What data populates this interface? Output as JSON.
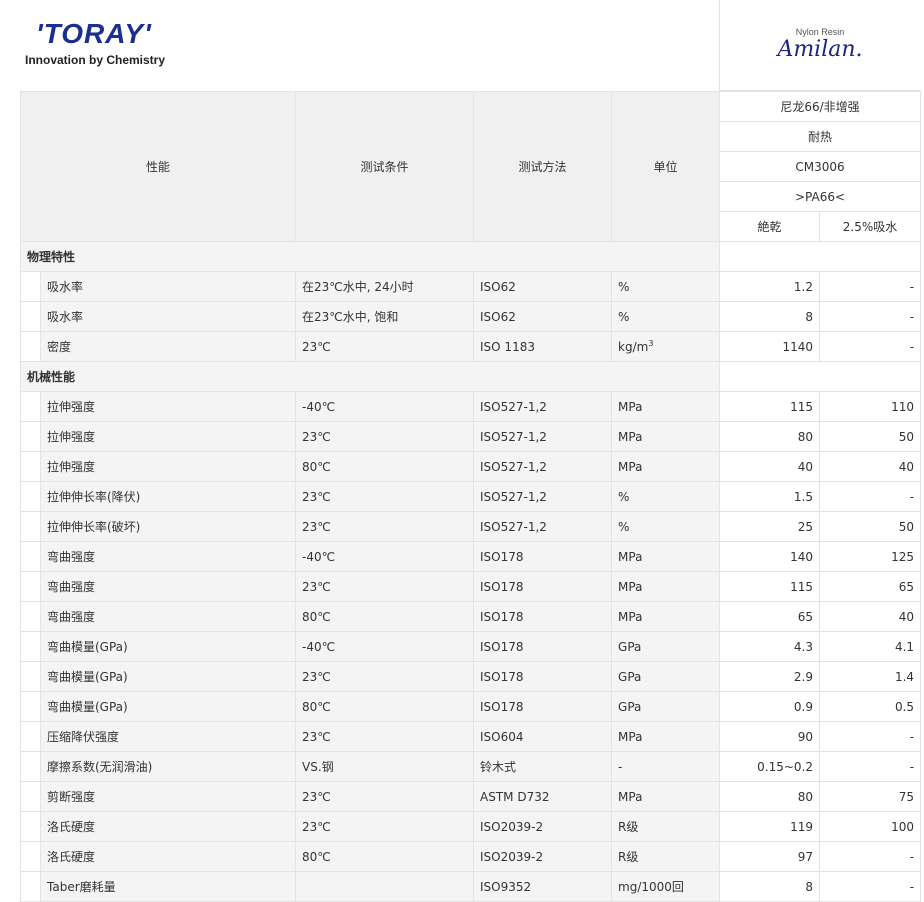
{
  "brand": {
    "logo_word": "'TORAY'",
    "tagline": "Innovation by Chemistry",
    "product_line": "Nylon Resin",
    "product_name": "Amilan."
  },
  "header": {
    "col_property": "性能",
    "col_condition": "测试条件",
    "col_method": "测试方法",
    "col_unit": "单位",
    "grade_type": "尼龙66/非增强",
    "grade_feature": "耐热",
    "grade_code": "CM3006",
    "grade_marking": ">PA66<",
    "state_dry": "絶乾",
    "state_wet": "2.5%吸水"
  },
  "sections": [
    {
      "title": "物理特性",
      "rows": [
        {
          "prop": "吸水率",
          "cond": "在23℃水中, 24小时",
          "method": "ISO62",
          "unit": "%",
          "dry": "1.2",
          "wet": "-"
        },
        {
          "prop": "吸水率",
          "cond": "在23℃水中, 饱和",
          "method": "ISO62",
          "unit": "%",
          "dry": "8",
          "wet": "-"
        },
        {
          "prop": "密度",
          "cond": "23℃",
          "method": "ISO 1183",
          "unit": "kg/m",
          "unit_sup": "3",
          "dry": "1140",
          "wet": "-"
        }
      ]
    },
    {
      "title": "机械性能",
      "rows": [
        {
          "prop": "拉伸强度",
          "cond": "-40℃",
          "method": "ISO527-1,2",
          "unit": "MPa",
          "dry": "115",
          "wet": "110"
        },
        {
          "prop": "拉伸强度",
          "cond": "23℃",
          "method": "ISO527-1,2",
          "unit": "MPa",
          "dry": "80",
          "wet": "50"
        },
        {
          "prop": "拉伸强度",
          "cond": "80℃",
          "method": "ISO527-1,2",
          "unit": "MPa",
          "dry": "40",
          "wet": "40"
        },
        {
          "prop": "拉伸伸长率(降伏)",
          "cond": "23℃",
          "method": "ISO527-1,2",
          "unit": "%",
          "dry": "1.5",
          "wet": "-"
        },
        {
          "prop": "拉伸伸长率(破坏)",
          "cond": "23℃",
          "method": "ISO527-1,2",
          "unit": "%",
          "dry": "25",
          "wet": "50"
        },
        {
          "prop": "弯曲强度",
          "cond": "-40℃",
          "method": "ISO178",
          "unit": "MPa",
          "dry": "140",
          "wet": "125"
        },
        {
          "prop": "弯曲强度",
          "cond": "23℃",
          "method": "ISO178",
          "unit": "MPa",
          "dry": "115",
          "wet": "65"
        },
        {
          "prop": "弯曲强度",
          "cond": "80℃",
          "method": "ISO178",
          "unit": "MPa",
          "dry": "65",
          "wet": "40"
        },
        {
          "prop": "弯曲模量(GPa)",
          "cond": "-40℃",
          "method": "ISO178",
          "unit": "GPa",
          "dry": "4.3",
          "wet": "4.1"
        },
        {
          "prop": "弯曲模量(GPa)",
          "cond": "23℃",
          "method": "ISO178",
          "unit": "GPa",
          "dry": "2.9",
          "wet": "1.4"
        },
        {
          "prop": "弯曲模量(GPa)",
          "cond": "80℃",
          "method": "ISO178",
          "unit": "GPa",
          "dry": "0.9",
          "wet": "0.5"
        },
        {
          "prop": "压缩降伏强度",
          "cond": "23℃",
          "method": "ISO604",
          "unit": "MPa",
          "dry": "90",
          "wet": "-"
        },
        {
          "prop": "摩擦系数(无润滑油)",
          "cond": "VS.钢",
          "method": "铃木式",
          "unit": "-",
          "dry": "0.15~0.2",
          "wet": "-"
        },
        {
          "prop": "剪断强度",
          "cond": "23℃",
          "method": "ASTM D732",
          "unit": "MPa",
          "dry": "80",
          "wet": "75"
        },
        {
          "prop": "洛氏硬度",
          "cond": "23℃",
          "method": "ISO2039-2",
          "unit": "R级",
          "dry": "119",
          "wet": "100"
        },
        {
          "prop": "洛氏硬度",
          "cond": "80℃",
          "method": "ISO2039-2",
          "unit": "R级",
          "dry": "97",
          "wet": "-"
        },
        {
          "prop": "Taber磨耗量",
          "cond": "",
          "method": "ISO9352",
          "unit": "mg/1000回",
          "dry": "8",
          "wet": "-"
        }
      ]
    }
  ]
}
